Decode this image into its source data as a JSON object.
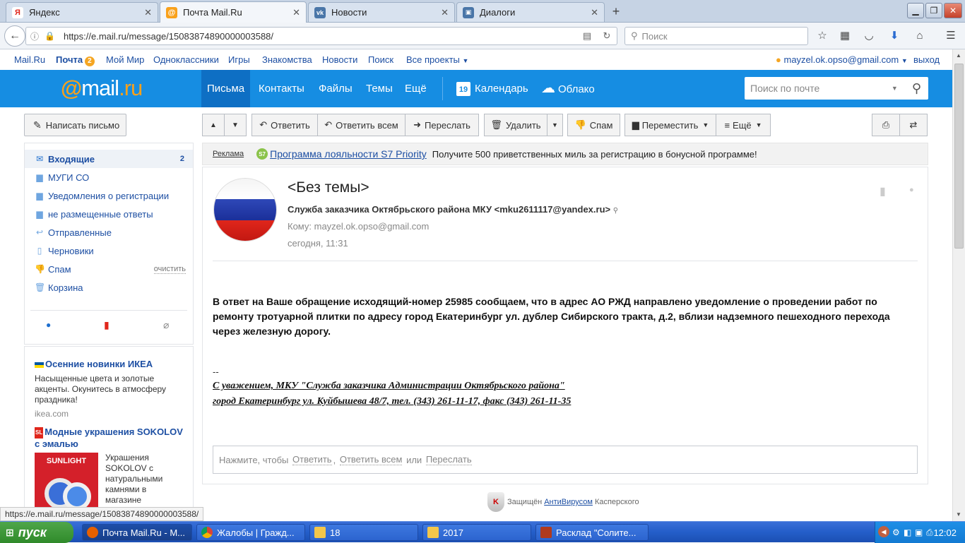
{
  "browser": {
    "tabs": [
      {
        "label": "Яндекс",
        "icon": "yandex-icon",
        "color": "#ffffff",
        "glyph": "Я"
      },
      {
        "label": "Почта Mail.Ru",
        "icon": "mailru-icon",
        "color": "#f9a11b",
        "glyph": "@"
      },
      {
        "label": "Новости",
        "icon": "vk-icon",
        "color": "#4a76a8",
        "glyph": "vk"
      },
      {
        "label": "Диалоги",
        "icon": "dialog-icon",
        "color": "#4a76a8",
        "glyph": "▣"
      }
    ],
    "url": "https://e.mail.ru/message/15083874890000003588/",
    "search_placeholder": "Поиск",
    "status_url": "https://e.mail.ru/message/15083874890000003588/"
  },
  "portal": {
    "links": [
      "Mail.Ru",
      "Почта",
      "Мой Мир",
      "Одноклассники",
      "Игры",
      "Знакомства",
      "Новости",
      "Поиск",
      "Все проекты"
    ],
    "mail_badge": "2",
    "user_email": "mayzel.ok.opso@gmail.com",
    "logout": "выход"
  },
  "header": {
    "logo_at": "@",
    "logo_mail": "mail",
    "logo_ru": ".ru",
    "nav": [
      "Письма",
      "Контакты",
      "Файлы",
      "Темы",
      "Ещё"
    ],
    "calendar": "Календарь",
    "calendar_day": "19",
    "cloud": "Облако",
    "search_placeholder": "Поиск по почте"
  },
  "sidebar": {
    "write_button": "Написать письмо",
    "folders": [
      {
        "label": "Входящие",
        "count": "2",
        "icon": "inbox-icon"
      },
      {
        "label": "МУГИ СО",
        "icon": "folder-icon"
      },
      {
        "label": "Уведомления о регистрации",
        "icon": "folder-icon"
      },
      {
        "label": "не размещенные ответы",
        "icon": "folder-icon"
      },
      {
        "label": "Отправленные",
        "icon": "sent-icon"
      },
      {
        "label": "Черновики",
        "icon": "drafts-icon"
      },
      {
        "label": "Спам",
        "icon": "spam-icon",
        "action": "очистить"
      },
      {
        "label": "Корзина",
        "icon": "trash-icon"
      }
    ],
    "ads": [
      {
        "title": "Осенние новинки ИКЕА",
        "text": "Насыщенные цвета и золотые акценты. Окунитесь в атмосферу праздника!",
        "domain": "ikea.com"
      },
      {
        "title": "Модные украшения SOKOLOV с эмалью",
        "text": "Украшения SOKOLOV с натуральными камнями в магазине",
        "brand": "SUNLIGHT",
        "badge": "SL"
      }
    ]
  },
  "toolbar": {
    "reply": "Ответить",
    "reply_all": "Ответить всем",
    "forward": "Переслать",
    "delete": "Удалить",
    "spam": "Спам",
    "move": "Переместить",
    "more": "Ещё"
  },
  "promo": {
    "label": "Реклама",
    "link": "Программа лояльности S7 Priority",
    "text": "Получите 500 приветственных миль за регистрацию в бонусной программе!",
    "logo": "S7"
  },
  "message": {
    "subject": "<Без темы>",
    "from": "Служба заказчика Октябрьского района МКУ <mku2611117@yandex.ru>",
    "to": "Кому: mayzel.ok.opso@gmail.com",
    "date": "сегодня, 11:31",
    "body": "В ответ на Ваше обращение исходящий-номер 25985 сообщаем, что в адрес АО РЖД направлено уведомление о проведении работ по ремонту тротуарной плитки по адресу город Екатеринбург ул. дублер Сибирского тракта, д.2, вблизи надземного пешеходного перехода через железную дорогу.",
    "sig_dash": "--",
    "sig_line1": "С уважением, МКУ \"Служба заказчика Администрации Октябрьского района\"",
    "sig_line2": "город Екатеринбург ул. Куйбышева 48/7, тел. (343) 261-11-17, факс (343) 261-11-35",
    "reply_prefix": "Нажмите, чтобы",
    "reply_link1": "Ответить",
    "reply_sep": ",",
    "reply_link2": "Ответить всем",
    "reply_or": "или",
    "reply_link3": "Переслать"
  },
  "kaspersky": {
    "prefix": "Защищён",
    "link": "АнтиВирусом",
    "suffix": "Касперского"
  },
  "taskbar": {
    "start": "пуск",
    "tasks": [
      "Почта Mail.Ru - M...",
      "Жалобы | Гражд...",
      "18",
      "2017",
      "Расклад \"Солите..."
    ],
    "clock": "12:02"
  }
}
